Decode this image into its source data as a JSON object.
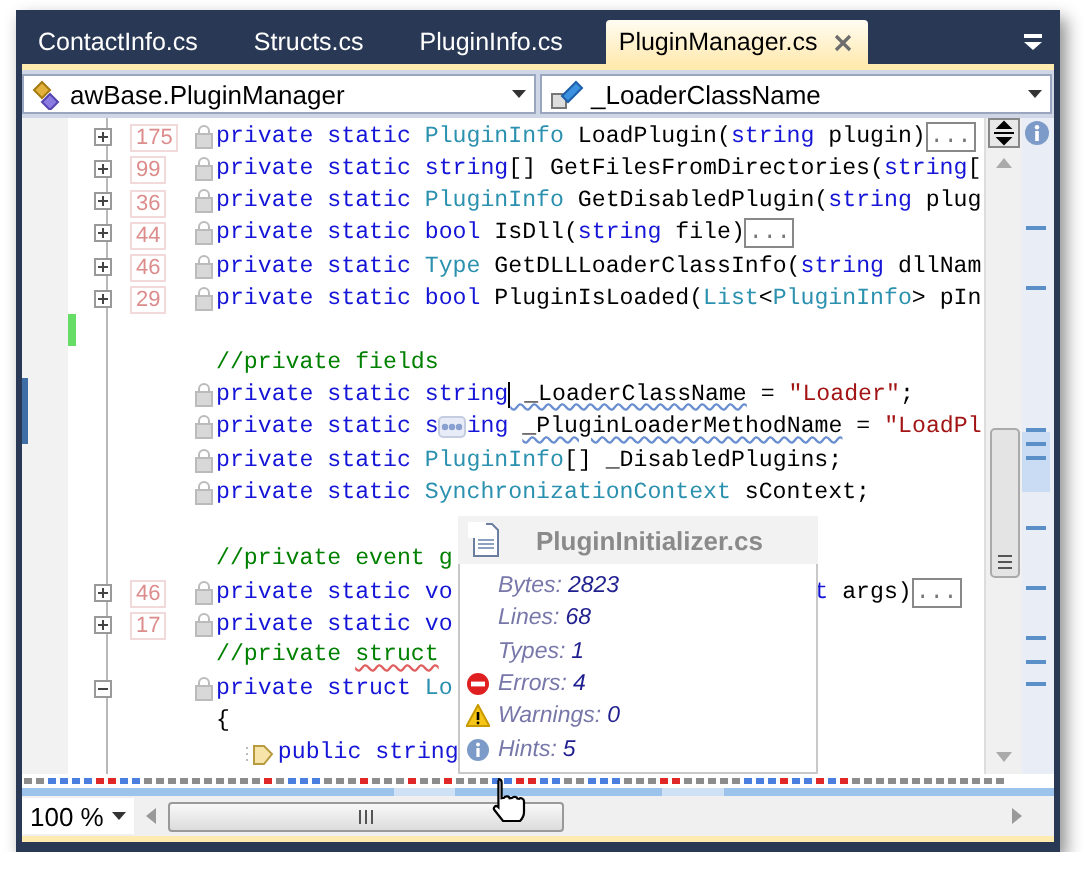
{
  "tabs": [
    {
      "label": "ContactInfo.cs",
      "selected": false
    },
    {
      "label": "Structs.cs",
      "selected": false
    },
    {
      "label": "PluginInfo.cs",
      "selected": false
    },
    {
      "label": "PluginManager.cs",
      "selected": true
    }
  ],
  "navigation": {
    "type_combo": "awBase.PluginManager",
    "member_combo": "_LoaderClassName"
  },
  "lines": [
    {
      "foldable": true,
      "expanded": false,
      "count": "175",
      "lock": true,
      "tokens": [
        {
          "t": "private static ",
          "kind": "keyword"
        },
        {
          "t": "PluginInfo",
          "kind": "type"
        },
        {
          "t": " LoadPlugin("
        },
        {
          "t": "string",
          "kind": "keyword"
        },
        {
          "t": " plugin)"
        },
        {
          "t": "...",
          "kind": "collapsed"
        }
      ]
    },
    {
      "foldable": true,
      "expanded": false,
      "count": "99",
      "lock": true,
      "tokens": [
        {
          "t": "private static string",
          "kind": "keyword"
        },
        {
          "t": "[] GetFilesFromDirectories("
        },
        {
          "t": "string",
          "kind": "keyword"
        },
        {
          "t": "["
        }
      ]
    },
    {
      "foldable": true,
      "expanded": false,
      "count": "36",
      "lock": true,
      "tokens": [
        {
          "t": "private static ",
          "kind": "keyword"
        },
        {
          "t": "PluginInfo",
          "kind": "type"
        },
        {
          "t": " GetDisabledPlugin("
        },
        {
          "t": "string",
          "kind": "keyword"
        },
        {
          "t": " plug"
        }
      ]
    },
    {
      "foldable": true,
      "expanded": false,
      "count": "44",
      "lock": true,
      "tokens": [
        {
          "t": "private static bool",
          "kind": "keyword"
        },
        {
          "t": " IsDll("
        },
        {
          "t": "string",
          "kind": "keyword"
        },
        {
          "t": " file)"
        },
        {
          "t": "...",
          "kind": "collapsed"
        }
      ]
    },
    {
      "foldable": true,
      "expanded": false,
      "count": "46",
      "lock": true,
      "tokens": [
        {
          "t": "private static ",
          "kind": "keyword"
        },
        {
          "t": "Type",
          "kind": "type"
        },
        {
          "t": " GetDLLLoaderClassInfo("
        },
        {
          "t": "string",
          "kind": "keyword"
        },
        {
          "t": " dllNam"
        }
      ]
    },
    {
      "foldable": true,
      "expanded": false,
      "count": "29",
      "lock": true,
      "tokens": [
        {
          "t": "private static bool",
          "kind": "keyword"
        },
        {
          "t": " PluginIsLoaded("
        },
        {
          "t": "List",
          "kind": "type"
        },
        {
          "t": "<"
        },
        {
          "t": "PluginInfo",
          "kind": "type"
        },
        {
          "t": "> pIn"
        }
      ]
    },
    {
      "added": true
    },
    {
      "tokens": [
        {
          "t": "//private fields",
          "kind": "comment"
        }
      ]
    },
    {
      "saved": true,
      "lock": true,
      "tokens": [
        {
          "t": "private static string",
          "kind": "keyword"
        },
        {
          "kind": "caret"
        },
        {
          "t": " _LoaderClassName",
          "hint": true
        },
        {
          "t": " = "
        },
        {
          "t": "\"Loader\"",
          "kind": "string"
        },
        {
          "t": ";"
        }
      ]
    },
    {
      "saved": true,
      "lock": true,
      "tokens": [
        {
          "t": "private static s",
          "kind": "keyword"
        },
        {
          "kind": "smart-tag"
        },
        {
          "t": "ing ",
          "kind": "keyword"
        },
        {
          "t": "_PluginLoaderMethodName",
          "hint": true
        },
        {
          "t": " = "
        },
        {
          "t": "\"LoadPl",
          "kind": "string"
        }
      ]
    },
    {
      "lock": true,
      "tokens": [
        {
          "t": "private static ",
          "kind": "keyword"
        },
        {
          "t": "PluginInfo",
          "kind": "type"
        },
        {
          "t": "[] _DisabledPlugins;"
        }
      ]
    },
    {
      "lock": true,
      "tokens": [
        {
          "t": "private static ",
          "kind": "keyword"
        },
        {
          "t": "SynchronizationContext",
          "kind": "type"
        },
        {
          "t": " sContext;"
        }
      ]
    },
    {
      "blank_before": true,
      "tokens": [
        {
          "t": "//private event g",
          "kind": "comment"
        }
      ]
    },
    {
      "foldable": true,
      "expanded": false,
      "count": "46",
      "lock": true,
      "tokens": [
        {
          "t": "private static vo",
          "kind": "keyword"
        }
      ],
      "tail": [
        {
          "t": "t",
          "kind": "keyword"
        },
        {
          "t": " args)"
        },
        {
          "t": "...",
          "kind": "collapsed"
        }
      ]
    },
    {
      "foldable": true,
      "expanded": false,
      "count": "17",
      "lock": true,
      "tokens": [
        {
          "t": "private static vo",
          "kind": "keyword"
        }
      ]
    },
    {
      "tokens": [
        {
          "t": "//private ",
          "kind": "comment"
        },
        {
          "t": "struct",
          "kind": "comment",
          "warning": true
        }
      ]
    },
    {
      "foldable": true,
      "expanded": true,
      "lock": true,
      "tokens": [
        {
          "t": "private struct ",
          "kind": "keyword"
        },
        {
          "t": "Lo",
          "kind": "type"
        }
      ]
    },
    {
      "tokens": [
        {
          "t": "{"
        }
      ]
    },
    {
      "member_icon": true,
      "tokens": [
        {
          "t": "public string",
          "kind": "keyword"
        }
      ]
    }
  ],
  "file_tooltip": {
    "title": "PluginInitializer.cs",
    "stats": [
      {
        "label": "Bytes:",
        "value": "2823",
        "kind": "plain"
      },
      {
        "label": "Lines:",
        "value": "68",
        "kind": "plain"
      },
      {
        "label": "Types:",
        "value": "1",
        "kind": "plain"
      },
      {
        "label": "Errors:",
        "value": "4",
        "kind": "error"
      },
      {
        "label": "Warnings:",
        "value": "0",
        "kind": "warning"
      },
      {
        "label": "Hints:",
        "value": "5",
        "kind": "hint"
      }
    ]
  },
  "zoom": {
    "value": "100 %"
  }
}
